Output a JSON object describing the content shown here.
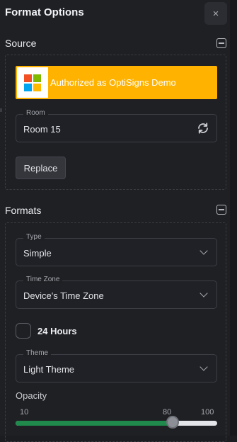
{
  "header": {
    "title": "Format Options",
    "close_label": "×"
  },
  "source": {
    "title": "Source",
    "auth_text": "Authorized as OptiSigns Demo",
    "room_label": "Room",
    "room_value": "Room 15",
    "replace_label": "Replace"
  },
  "formats": {
    "title": "Formats",
    "type_label": "Type",
    "type_value": "Simple",
    "timezone_label": "Time Zone",
    "timezone_value": "Device's Time Zone",
    "hours_label": "24 Hours",
    "hours_checked": false,
    "theme_label": "Theme",
    "theme_value": "Light Theme",
    "opacity_label": "Opacity",
    "opacity_min": "10",
    "opacity_value": "80",
    "opacity_max": "100",
    "opacity_fraction": 0.78
  },
  "colors": {
    "auth_bar": "#ffb300",
    "slider_fill": "#1f8a4c",
    "ms_red": "#f25022",
    "ms_green": "#7fba00",
    "ms_blue": "#00a4ef",
    "ms_yellow": "#ffb900"
  },
  "icons": [
    "close-icon",
    "collapse-icon",
    "microsoft-logo-icon",
    "refresh-icon",
    "chevron-down-icon"
  ]
}
